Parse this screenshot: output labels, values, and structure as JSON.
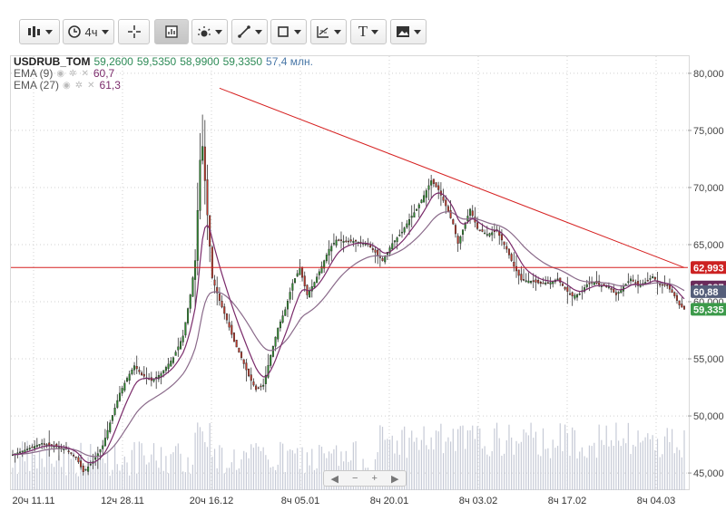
{
  "toolbar": {
    "interval_label": "4ч",
    "text_tool_label": "T"
  },
  "legend": {
    "symbol": "USDRUB_TOM",
    "open": "59,2600",
    "high": "59,5350",
    "low": "58,9900",
    "close": "59,3350",
    "volume": "57,4 млн.",
    "ema9_label": "EMA (9)",
    "ema9_value": "60,7",
    "ema27_label": "EMA (27)",
    "ema27_value": "61,3"
  },
  "colors": {
    "up": "#2e8b2e",
    "down": "#c0392b",
    "ema9": "#7a2a6a",
    "ema27": "#8a6a8a",
    "trendline": "#d62020",
    "volume": "#c6cad6"
  },
  "chart_data": {
    "type": "candlestick",
    "title": "USDRUB_TOM",
    "y_axis": {
      "ylim": [
        43500,
        81500
      ],
      "ticks": [
        "80,000",
        "75,000",
        "70,000",
        "65,000",
        "60,000",
        "55,000",
        "50,000",
        "45,000"
      ],
      "tick_values": [
        80000,
        75000,
        70000,
        65000,
        60000,
        55000,
        50000,
        45000
      ]
    },
    "x_axis": {
      "ticks": [
        "20ч 11.11",
        "12ч 28.11",
        "20ч 16.12",
        "8ч 05.01",
        "8ч 20.01",
        "8ч 03.02",
        "8ч 17.02",
        "8ч 04.03"
      ]
    },
    "price_path": [
      [
        0,
        46600
      ],
      [
        6,
        47100
      ],
      [
        12,
        47600
      ],
      [
        18,
        47300
      ],
      [
        22,
        47100
      ],
      [
        26,
        46400
      ],
      [
        29,
        45100
      ],
      [
        33,
        46000
      ],
      [
        37,
        47400
      ],
      [
        40,
        49400
      ],
      [
        44,
        52000
      ],
      [
        47,
        53300
      ],
      [
        50,
        54400
      ],
      [
        53,
        53600
      ],
      [
        57,
        53100
      ],
      [
        61,
        53700
      ],
      [
        66,
        55100
      ],
      [
        70,
        57000
      ],
      [
        73,
        60600
      ],
      [
        75,
        63600
      ],
      [
        77,
        72400
      ],
      [
        78,
        73600
      ],
      [
        80,
        67600
      ],
      [
        82,
        62100
      ],
      [
        85,
        60100
      ],
      [
        88,
        58400
      ],
      [
        91,
        56500
      ],
      [
        94,
        55100
      ],
      [
        97,
        53500
      ],
      [
        100,
        52300
      ],
      [
        103,
        52700
      ],
      [
        106,
        55300
      ],
      [
        109,
        57700
      ],
      [
        112,
        59300
      ],
      [
        115,
        61600
      ],
      [
        118,
        62900
      ],
      [
        121,
        60600
      ],
      [
        124,
        61700
      ],
      [
        127,
        63100
      ],
      [
        130,
        64600
      ],
      [
        133,
        65400
      ],
      [
        136,
        65300
      ],
      [
        141,
        65300
      ],
      [
        146,
        65000
      ],
      [
        150,
        64100
      ],
      [
        152,
        63600
      ],
      [
        156,
        65100
      ],
      [
        160,
        66100
      ],
      [
        163,
        67200
      ],
      [
        166,
        68100
      ],
      [
        169,
        69300
      ],
      [
        172,
        70600
      ],
      [
        175,
        69800
      ],
      [
        178,
        68400
      ],
      [
        181,
        66800
      ],
      [
        183,
        65100
      ],
      [
        186,
        66900
      ],
      [
        188,
        68100
      ],
      [
        191,
        66400
      ],
      [
        195,
        65900
      ],
      [
        199,
        66200
      ],
      [
        203,
        64600
      ],
      [
        206,
        63100
      ],
      [
        209,
        61900
      ],
      [
        213,
        61800
      ],
      [
        217,
        61600
      ],
      [
        221,
        61700
      ],
      [
        224,
        62000
      ],
      [
        227,
        61100
      ],
      [
        230,
        60500
      ],
      [
        233,
        60700
      ],
      [
        236,
        61500
      ],
      [
        239,
        61700
      ],
      [
        242,
        61400
      ],
      [
        245,
        61300
      ],
      [
        248,
        60600
      ],
      [
        251,
        61300
      ],
      [
        254,
        62000
      ],
      [
        257,
        61400
      ],
      [
        260,
        61700
      ],
      [
        263,
        62200
      ],
      [
        266,
        61500
      ],
      [
        269,
        61400
      ],
      [
        272,
        60500
      ],
      [
        274,
        59700
      ],
      [
        276,
        59335
      ]
    ],
    "ema": [
      {
        "name": "EMA (9)",
        "value": 60.7
      },
      {
        "name": "EMA (27)",
        "value": 61.3
      }
    ],
    "horizontal_line": 62993,
    "trendline": [
      [
        85,
        78700
      ],
      [
        276,
        62993
      ]
    ],
    "price_labels": [
      {
        "text": "62,993",
        "value": 62993,
        "color": "#cc2222"
      },
      {
        "text": "61,287",
        "value": 61287,
        "color": "#6a2a5a"
      },
      {
        "text": "60,88",
        "value": 60880,
        "color": "#555e7a"
      },
      {
        "text": "59,335",
        "value": 59335,
        "color": "#3c9a4a"
      }
    ]
  }
}
